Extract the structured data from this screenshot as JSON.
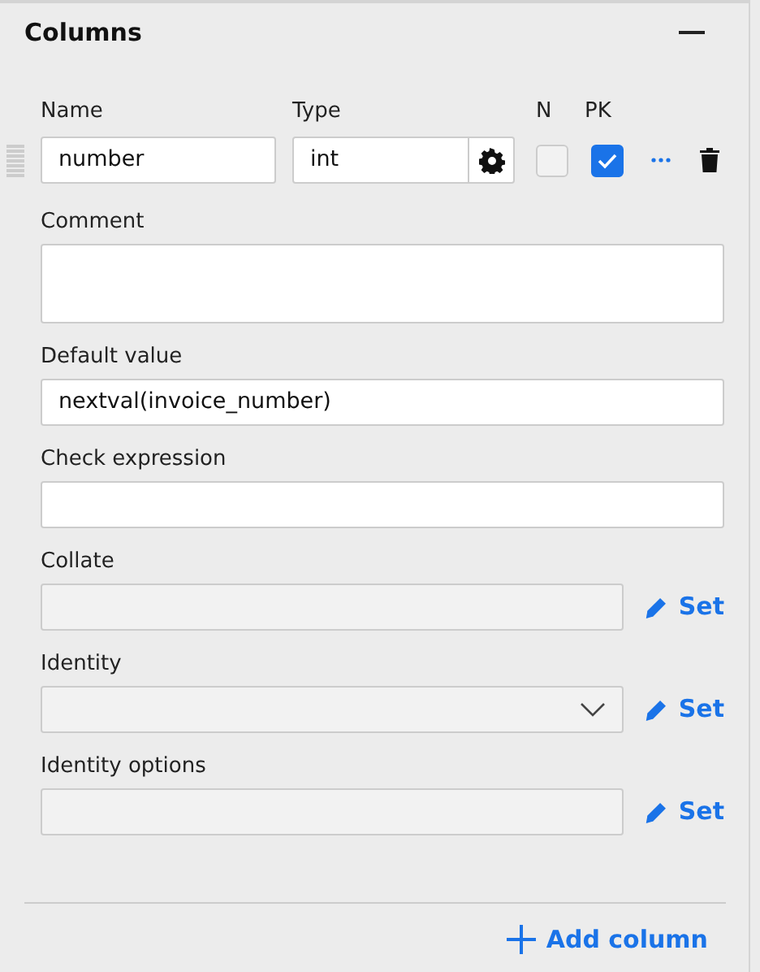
{
  "panel": {
    "title": "Columns"
  },
  "headers": [
    "Name",
    "Type",
    "N",
    "PK"
  ],
  "column": {
    "name": "number",
    "type": "int",
    "nullable": false,
    "primary_key": true
  },
  "fields": [
    {
      "kind": "textarea",
      "label": "Comment"
    },
    {
      "kind": "input",
      "label": "Default value",
      "value": "nextval(invoice_number)"
    },
    {
      "kind": "input",
      "label": "Check expression"
    },
    {
      "kind": "readonly",
      "label": "Collate",
      "action": "Set"
    },
    {
      "kind": "select",
      "label": "Identity",
      "action": "Set"
    },
    {
      "kind": "readonly",
      "label": "Identity options",
      "action": "Set"
    }
  ],
  "add_button": "Add column"
}
